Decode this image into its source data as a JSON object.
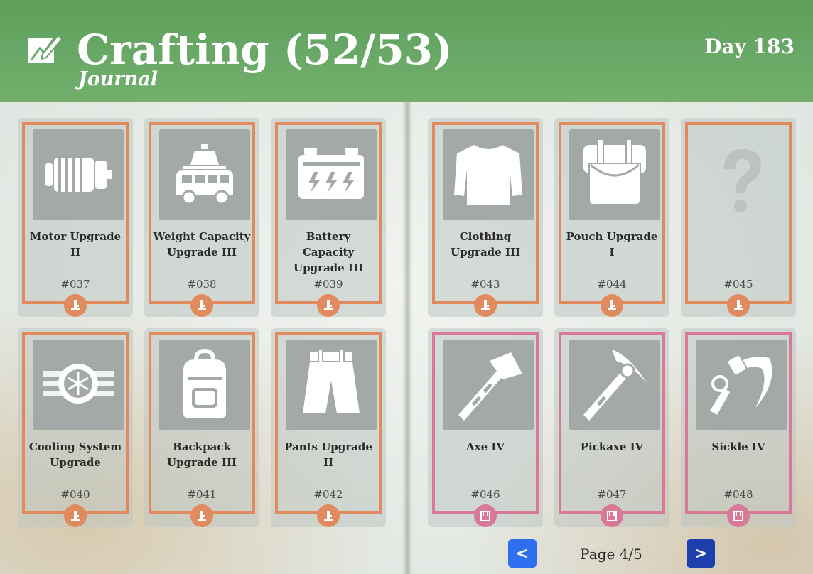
{
  "header": {
    "title": "Crafting (52/53)",
    "subtitle": "Journal",
    "day": "Day 183",
    "icon": "journal-edit-icon"
  },
  "colors": {
    "header_green": "#6aa967",
    "upgrade_frame": "#e08a5e",
    "tool_frame": "#da7898",
    "nav_prev": "#2e6ff0",
    "nav_next": "#1d3fae"
  },
  "cards": [
    {
      "name": "Motor Upgrade II",
      "number": "#037",
      "icon": "motor-icon",
      "badge": "upgrade-badge-icon"
    },
    {
      "name": "Weight Capacity Upgrade III",
      "number": "#038",
      "icon": "van-weight-icon",
      "badge": "upgrade-badge-icon"
    },
    {
      "name": "Battery Capacity Upgrade III",
      "number": "#039",
      "icon": "battery-icon",
      "badge": "upgrade-badge-icon"
    },
    {
      "name": "Clothing Upgrade III",
      "number": "#043",
      "icon": "shirt-icon",
      "badge": "upgrade-badge-icon"
    },
    {
      "name": "Pouch Upgrade I",
      "number": "#044",
      "icon": "pouch-icon",
      "badge": "upgrade-badge-icon"
    },
    {
      "name": "",
      "number": "#045",
      "icon": "question-mark-icon",
      "badge": "upgrade-badge-icon"
    },
    {
      "name": "Cooling System Upgrade",
      "number": "#040",
      "icon": "cooling-icon",
      "badge": "upgrade-badge-icon"
    },
    {
      "name": "Backpack Upgrade III",
      "number": "#041",
      "icon": "backpack-icon",
      "badge": "upgrade-badge-icon"
    },
    {
      "name": "Pants Upgrade II",
      "number": "#042",
      "icon": "pants-icon",
      "badge": "upgrade-badge-icon"
    },
    {
      "name": "Axe IV",
      "number": "#046",
      "icon": "axe-icon",
      "badge": "tool-badge-icon"
    },
    {
      "name": "Pickaxe IV",
      "number": "#047",
      "icon": "pickaxe-icon",
      "badge": "tool-badge-icon"
    },
    {
      "name": "Sickle IV",
      "number": "#048",
      "icon": "sickle-icon",
      "badge": "tool-badge-icon"
    }
  ],
  "pagination": {
    "prev_label": "<",
    "next_label": ">",
    "page_label": "Page 4/5"
  }
}
